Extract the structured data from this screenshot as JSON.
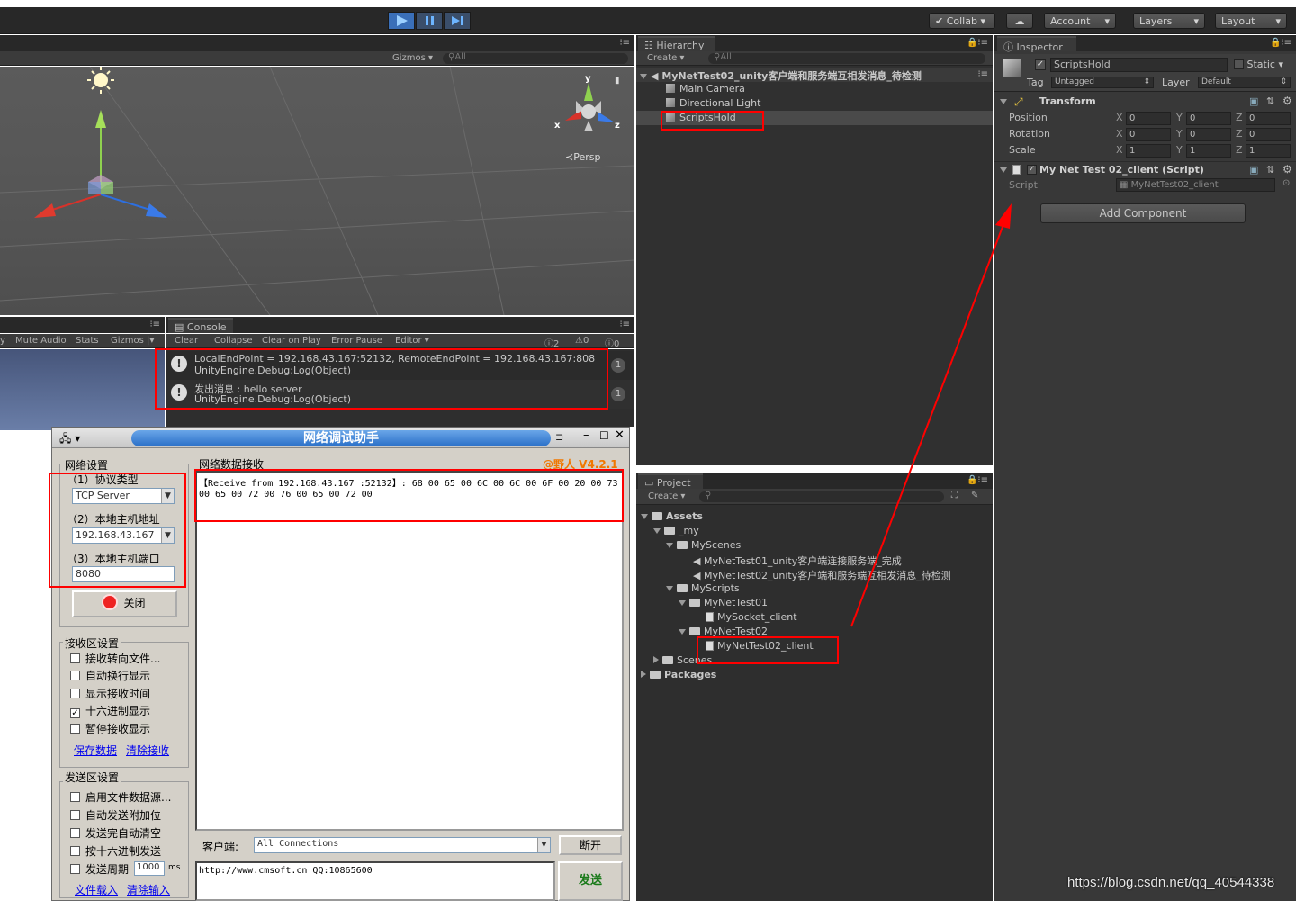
{
  "toolbar": {
    "collab": "Collab",
    "account": "Account",
    "layers": "Layers",
    "layout": "Layout"
  },
  "scene": {
    "gizmos": "Gizmos",
    "search_placeholder": "All",
    "persp": "Persp",
    "axis_y": "y",
    "axis_x": "x",
    "axis_z": "z"
  },
  "game_bar": {
    "mute": "Mute Audio",
    "stats": "Stats",
    "gizmos": "Gizmos"
  },
  "hierarchy": {
    "tab": "Hierarchy",
    "create": "Create",
    "search_placeholder": "All",
    "scene_name": "MyNetTest02_unity客户端和服务端互相发消息_待检测",
    "items": [
      "Main Camera",
      "Directional Light",
      "ScriptsHold"
    ]
  },
  "inspector": {
    "tab": "Inspector",
    "object_name": "ScriptsHold",
    "static": "Static",
    "tag_label": "Tag",
    "tag_value": "Untagged",
    "layer_label": "Layer",
    "layer_value": "Default",
    "transform": "Transform",
    "position": "Position",
    "rotation": "Rotation",
    "scale": "Scale",
    "x": "X",
    "y": "Y",
    "z": "Z",
    "pos_vals": [
      "0",
      "0",
      "0"
    ],
    "rot_vals": [
      "0",
      "0",
      "0"
    ],
    "scale_vals": [
      "1",
      "1",
      "1"
    ],
    "script_component": "My Net Test 02_client (Script)",
    "script_label": "Script",
    "script_value": "MyNetTest02_client",
    "add_component": "Add Component"
  },
  "console": {
    "tab": "Console",
    "clear": "Clear",
    "collapse": "Collapse",
    "clear_on_play": "Clear on Play",
    "error_pause": "Error Pause",
    "editor": "Editor",
    "count_log": "2",
    "count_warn": "0",
    "count_err": "0",
    "entries": [
      {
        "line1": "LocalEndPoint = 192.168.43.167:52132, RemoteEndPoint = 192.168.43.167:808",
        "line2": "UnityEngine.Debug:Log(Object)",
        "count": "1"
      },
      {
        "line1": "发出消息 : hello server",
        "line2": "UnityEngine.Debug:Log(Object)",
        "count": "1"
      }
    ]
  },
  "project": {
    "tab": "Project",
    "create": "Create",
    "assets": "Assets",
    "my": "_my",
    "myscenes": "MyScenes",
    "scene1": "MyNetTest01_unity客户端连接服务端_完成",
    "scene2": "MyNetTest02_unity客户端和服务端互相发消息_待检测",
    "myscripts": "MyScripts",
    "folder1": "MyNetTest01",
    "script1": "MySocket_client",
    "folder2": "MyNetTest02",
    "script2": "MyNetTest02_client",
    "scenes": "Scenes",
    "packages": "Packages"
  },
  "nettool": {
    "title": "网络调试助手",
    "version": "@野人 V4.2.1",
    "net_settings": "网络设置",
    "proto_label": "（1）协议类型",
    "proto_value": "TCP Server",
    "host_label": "（2）本地主机地址",
    "host_value": "192.168.43.167",
    "port_label": "（3）本地主机端口",
    "port_value": "8080",
    "close_btn": "关闭",
    "recv_settings": "接收区设置",
    "recv_opts": [
      "接收转向文件...",
      "自动换行显示",
      "显示接收时间",
      "十六进制显示",
      "暂停接收显示"
    ],
    "save_data": "保存数据",
    "clear_recv": "清除接收",
    "send_settings": "发送区设置",
    "send_opts": [
      "启用文件数据源...",
      "自动发送附加位",
      "发送完自动清空",
      "按十六进制发送"
    ],
    "send_period": "发送周期",
    "period_value": "1000",
    "ms": "ms",
    "load_file": "文件载入",
    "clear_input": "清除输入",
    "recv_title": "网络数据接收",
    "recv_line1": "【Receive from 192.168.43.167 :52132】: 68 00 65 00 6C 00 6C 00 6F 00 20 00 73",
    "recv_line2": "00 65 00 72 00 76 00 65 00 72 00",
    "client_label": "客户端:",
    "client_value": "All Connections",
    "disconnect": "断开",
    "send_text": "http://www.cmsoft.cn QQ:10865600",
    "send_btn": "发送"
  },
  "watermark": "https://blog.csdn.net/qq_40544338"
}
